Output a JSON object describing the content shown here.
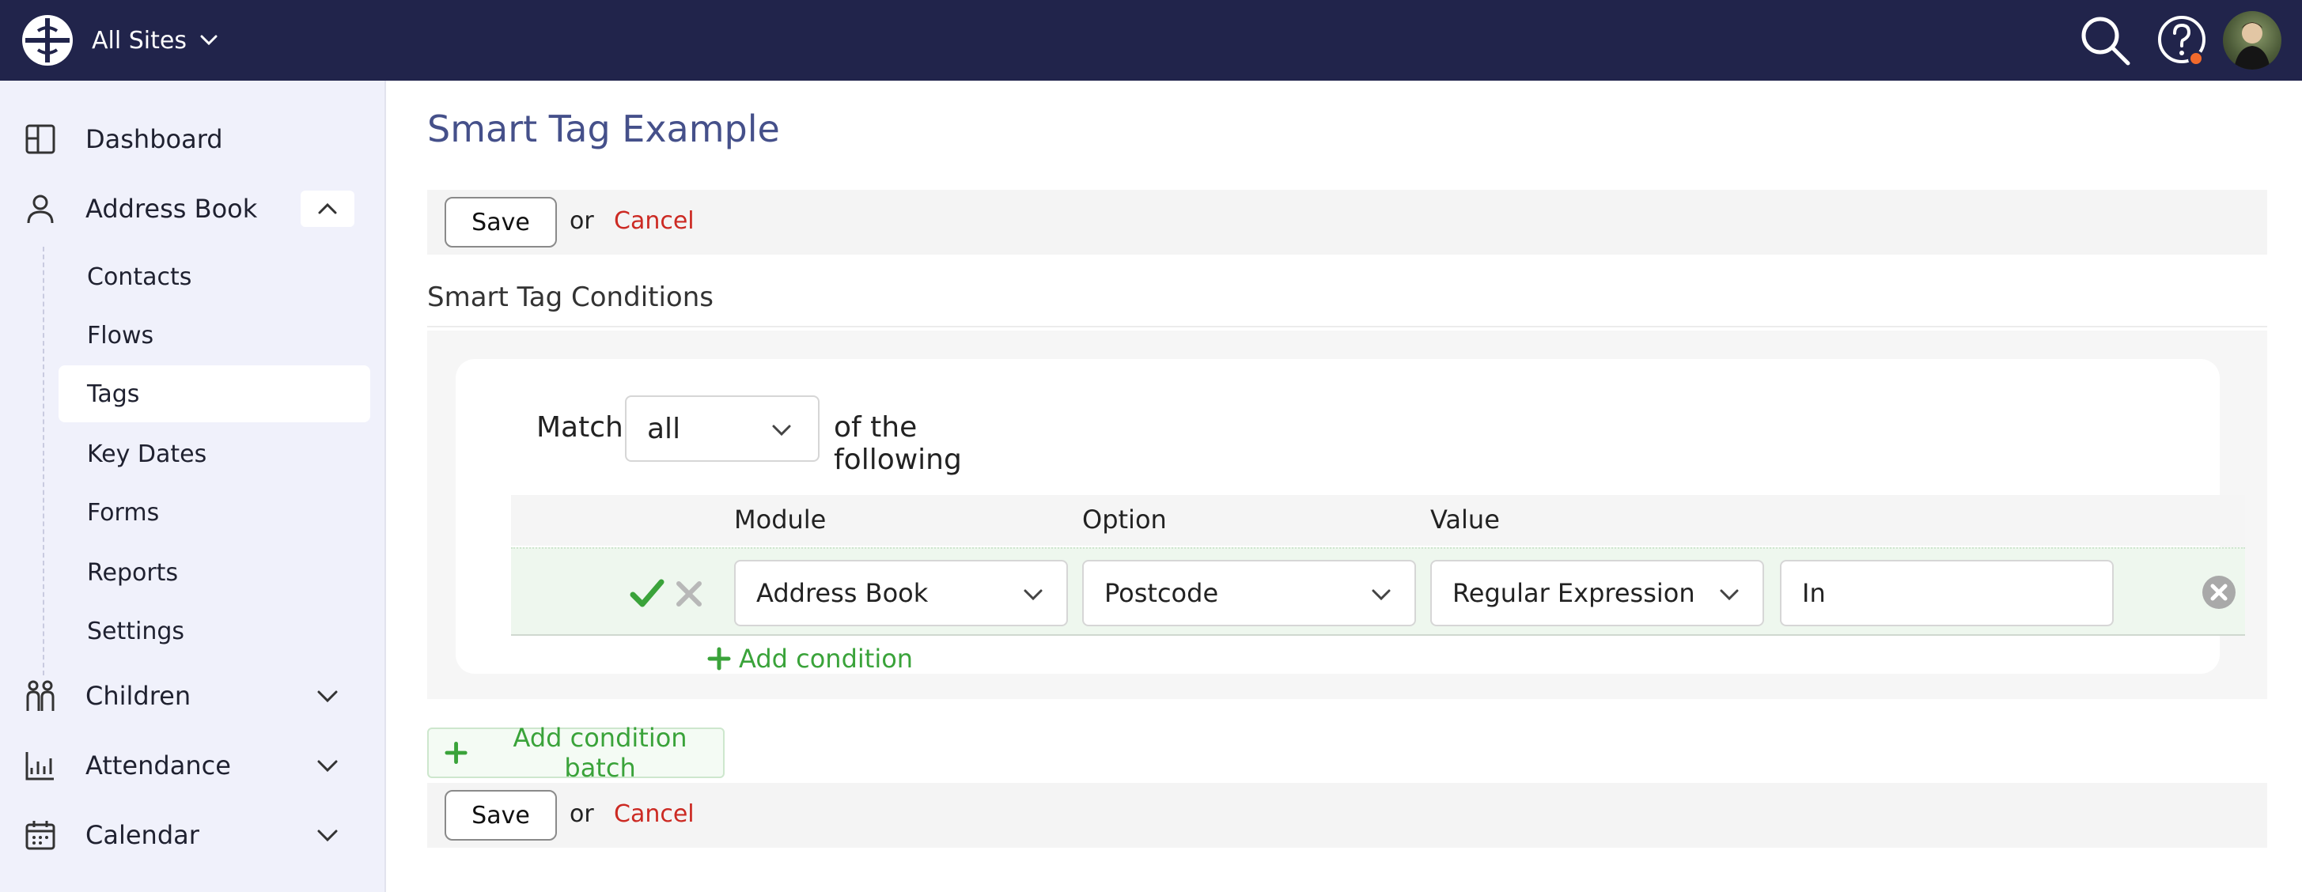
{
  "header": {
    "site_switcher_label": "All Sites",
    "colors": {
      "bar": "#21244b",
      "notification": "#f26a2c"
    },
    "icons": [
      "logo-icon",
      "chevron-down-icon",
      "search-icon",
      "help-icon"
    ]
  },
  "sidebar": {
    "items": [
      {
        "label": "Dashboard",
        "icon": "dashboard-icon"
      },
      {
        "label": "Address Book",
        "icon": "user-icon",
        "expanded": true
      },
      {
        "label": "Children",
        "icon": "children-icon"
      },
      {
        "label": "Attendance",
        "icon": "chart-icon"
      },
      {
        "label": "Calendar",
        "icon": "calendar-icon"
      }
    ],
    "address_book_sub": [
      "Contacts",
      "Flows",
      "Tags",
      "Key Dates",
      "Forms",
      "Reports",
      "Settings"
    ],
    "active_sub": "Tags"
  },
  "page": {
    "title": "Smart Tag Example",
    "save_label": "Save",
    "or_label": "or",
    "cancel_label": "Cancel",
    "section_title": "Smart Tag Conditions",
    "match_label": "Match",
    "match_value": "all",
    "match_tail": "of the following",
    "columns": {
      "module": "Module",
      "option": "Option",
      "value": "Value"
    },
    "condition": {
      "module": "Address Book",
      "option": "Postcode",
      "operator": "Regular Expression",
      "value": "In"
    },
    "add_condition_label": "Add condition",
    "add_batch_label": "Add condition batch",
    "colors": {
      "title": "#45508a",
      "cancel": "#cc2a23",
      "add": "#3aa33a"
    }
  }
}
